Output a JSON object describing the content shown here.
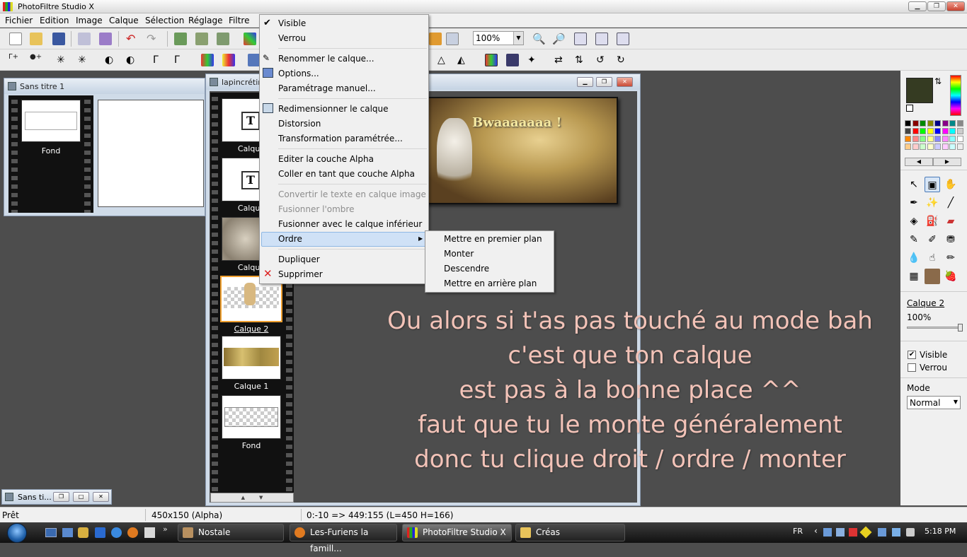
{
  "app": {
    "title": "PhotoFiltre Studio X"
  },
  "menubar": [
    "Fichier",
    "Edition",
    "Image",
    "Calque",
    "Sélection",
    "Réglage",
    "Filtre"
  ],
  "toolbar": {
    "zoom": "100%"
  },
  "win_small": {
    "title": "Sans titre 1",
    "layer": "Fond"
  },
  "win_main": {
    "title": "lapincrétin",
    "layers": [
      "Calque",
      "Calque",
      "Calque",
      "Calque 2",
      "Calque 1",
      "Fond"
    ]
  },
  "image_text": "Bwaaaaaaa !",
  "context_menu": {
    "visible": "Visible",
    "verrou": "Verrou",
    "renommer": "Renommer le calque...",
    "options": "Options...",
    "parametrage": "Paramétrage manuel...",
    "redimensionner": "Redimensionner le calque",
    "distorsion": "Distorsion",
    "transformation": "Transformation paramétrée...",
    "editer_alpha": "Editer la couche Alpha",
    "coller_alpha": "Coller en tant que couche Alpha",
    "convertir": "Convertir le texte en calque image",
    "fusionner_ombre": "Fusionner l'ombre",
    "fusionner_inf": "Fusionner avec le calque inférieur",
    "ordre": "Ordre",
    "dupliquer": "Dupliquer",
    "supprimer": "Supprimer"
  },
  "submenu": [
    "Mettre en premier plan",
    "Monter",
    "Descendre",
    "Mettre en arrière plan"
  ],
  "overlay_text": [
    "Ou alors si t'as pas touché au mode bah",
    "c'est que ton calque",
    "est pas à la bonne place ^^",
    "faut que tu le monte généralement",
    "donc tu clique droit / ordre / monter"
  ],
  "right_panel": {
    "layer_name": "Calque 2",
    "opacity": "100%",
    "visible": "Visible",
    "verrou": "Verrou",
    "mode_label": "Mode",
    "mode_value": "Normal",
    "visible_checked": true,
    "verrou_checked": false
  },
  "minimized": {
    "title": "Sans ti..."
  },
  "status": {
    "state": "Prêt",
    "size": "450x150 (Alpha)",
    "coords": "0:-10 => 449:155 (L=450  H=166)"
  },
  "taskbar": {
    "items": [
      "Nostale",
      "Les-Furiens la famill...",
      "PhotoFiltre Studio X",
      "Créas"
    ],
    "lang": "FR",
    "time": "5:18 PM"
  },
  "colors": {
    "foreground": "#353b22",
    "background": "#ffffff",
    "highlight": "#cfe1f6",
    "overlay_text": "#f3c3b8"
  }
}
